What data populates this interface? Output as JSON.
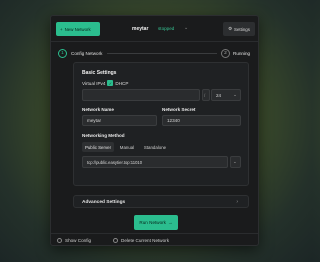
{
  "topbar": {
    "new_button": "New Network",
    "new_icon": "plus-icon",
    "doc_title": "meytar",
    "doc_status": "stopped",
    "dropdown_glyph": "⌄",
    "settings_button": "Settings",
    "settings_icon": "gear-icon"
  },
  "steps": [
    {
      "number": "1",
      "label": "Config Network"
    },
    {
      "number": "2",
      "label": "Running"
    }
  ],
  "basic": {
    "title": "Basic Settings",
    "ipv6_label": "Virtual IPv4",
    "dhcp_label": "DHCP",
    "ipv4_value": "",
    "cidr_value": "24",
    "network_name_label": "Network Name",
    "network_name_value": "meytar",
    "network_secret_label": "Network Secret",
    "network_secret_value": "12340",
    "method_label": "Networking Method",
    "methods": [
      "Public Server",
      "Manual",
      "Standalone"
    ],
    "active_method": "Public Server",
    "server_url": "tcp://public.easytier.top:11010"
  },
  "advanced": {
    "label": "Advanced Settings",
    "chevron": "›"
  },
  "next_button": "Run Network",
  "next_icon": "arrow-right-icon",
  "bottom": {
    "show_config": "Show Config",
    "delete_config": "Delete Current Network"
  },
  "colors": {
    "accent": "#2bbd8e",
    "window_bg": "#1a1b1c",
    "panel_bg": "#1f2123"
  }
}
